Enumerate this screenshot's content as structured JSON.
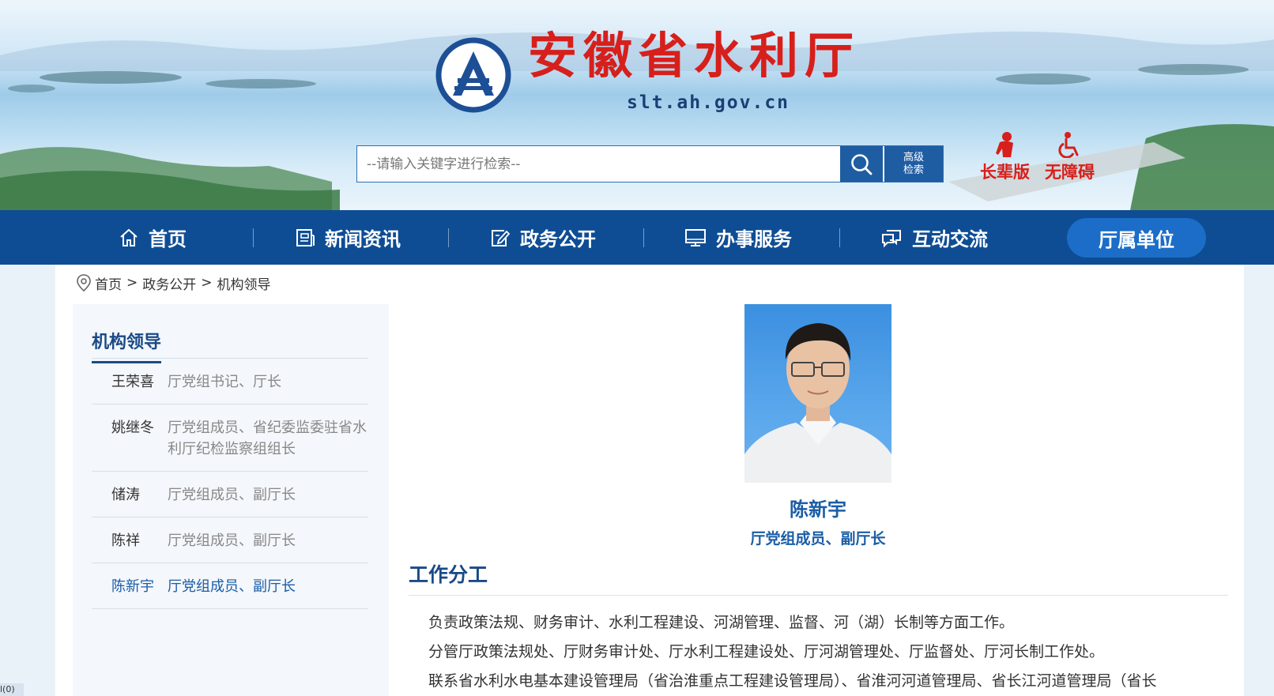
{
  "header": {
    "title": "安徽省水利厅",
    "domain": "slt.ah.gov.cn",
    "search": {
      "placeholder": "--请输入关键字进行检索--",
      "advanced_line1": "高级",
      "advanced_line2": "检索"
    },
    "elder_label": "长辈版",
    "accessible_label": "无障碍"
  },
  "nav": {
    "items": [
      {
        "label": "首页",
        "icon": "home-icon"
      },
      {
        "label": "新闻资讯",
        "icon": "news-icon"
      },
      {
        "label": "政务公开",
        "icon": "edit-doc-icon"
      },
      {
        "label": "办事服务",
        "icon": "monitor-icon"
      },
      {
        "label": "互动交流",
        "icon": "chat-icon"
      },
      {
        "label": "厅属单位",
        "icon": ""
      }
    ],
    "active": "厅属单位"
  },
  "breadcrumb": {
    "items": [
      "首页",
      "政务公开",
      "机构领导"
    ],
    "separator": ">"
  },
  "sidebar": {
    "title": "机构领导",
    "leaders": [
      {
        "name": "王荣喜",
        "post": "厅党组书记、厅长"
      },
      {
        "name": "姚继冬",
        "post": "厅党组成员、省纪委监委驻省水利厅纪检监察组组长"
      },
      {
        "name": "储涛",
        "post": "厅党组成员、副厅长"
      },
      {
        "name": "陈祥",
        "post": "厅党组成员、副厅长"
      },
      {
        "name": "陈新宇",
        "post": "厅党组成员、副厅长"
      }
    ],
    "active_index": 4
  },
  "profile": {
    "name": "陈新宇",
    "post": "厅党组成员、副厅长",
    "section_title": "工作分工",
    "duties": [
      "负责政策法规、财务审计、水利工程建设、河湖管理、监督、河（湖）长制等方面工作。",
      "分管厅政策法规处、厅财务审计处、厅水利工程建设处、厅河湖管理处、厅监督处、厅河长制工作处。",
      "联系省水利水电基本建设管理局（省治淮重点工程建设管理局）、省淮河河道管理局、省长江河道管理局（省长"
    ]
  },
  "corner_tag": "l(0)",
  "colors": {
    "nav_bg": "#0e4d94",
    "nav_active": "#1b6dc7",
    "title_red": "#d71f1b",
    "link_blue": "#1a5da6"
  }
}
